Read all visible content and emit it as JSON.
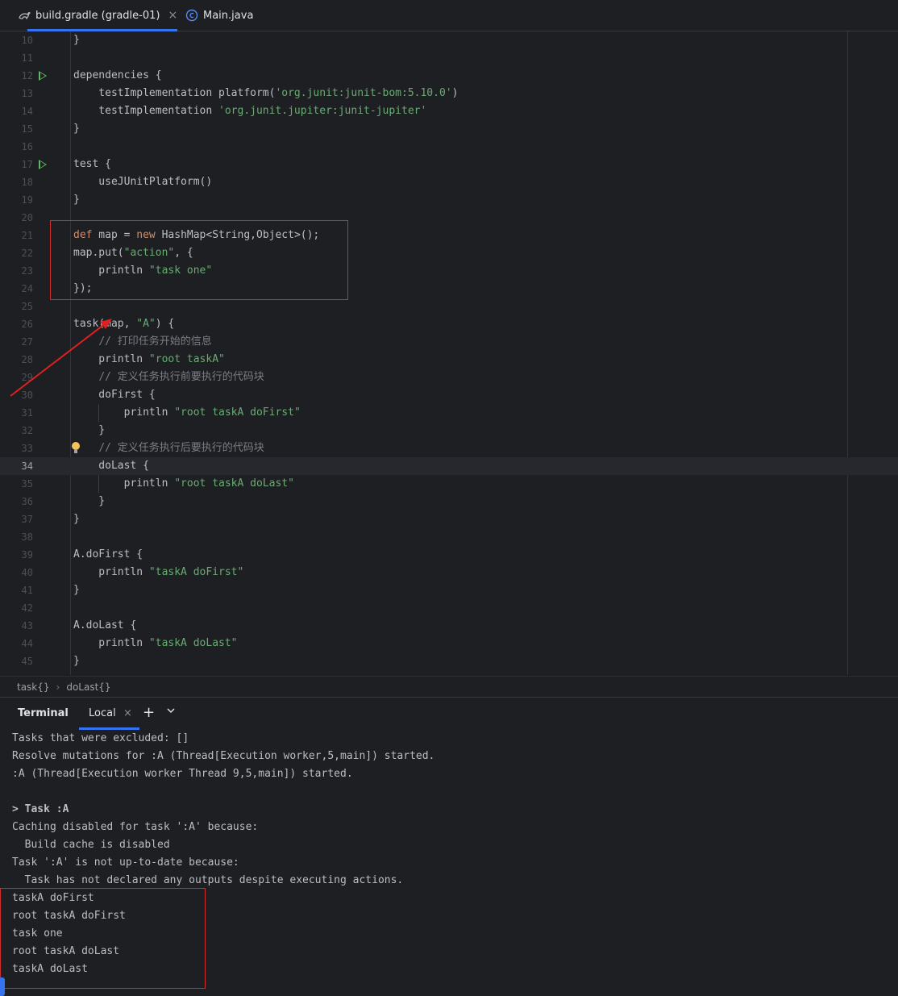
{
  "tabs": [
    {
      "label": "build.gradle (gradle-01)",
      "icon": "gradle-icon",
      "active": true
    },
    {
      "label": "Main.java",
      "icon": "java-class-icon",
      "active": false
    }
  ],
  "editor": {
    "lines": [
      {
        "n": "10",
        "text": "}"
      },
      {
        "n": "11",
        "text": ""
      },
      {
        "n": "12",
        "text": "dependencies {",
        "run": true
      },
      {
        "n": "13",
        "text": "    testImplementation platform('org.junit:junit-bom:5.10.0')"
      },
      {
        "n": "14",
        "text": "    testImplementation 'org.junit.jupiter:junit-jupiter'"
      },
      {
        "n": "15",
        "text": "}"
      },
      {
        "n": "16",
        "text": ""
      },
      {
        "n": "17",
        "text": "test {",
        "run": true
      },
      {
        "n": "18",
        "text": "    useJUnitPlatform()"
      },
      {
        "n": "19",
        "text": "}"
      },
      {
        "n": "20",
        "text": ""
      },
      {
        "n": "21",
        "text": "def map = new HashMap<String,Object>();"
      },
      {
        "n": "22",
        "text": "map.put(\"action\", {"
      },
      {
        "n": "23",
        "text": "    println \"task one\""
      },
      {
        "n": "24",
        "text": "});"
      },
      {
        "n": "25",
        "text": ""
      },
      {
        "n": "26",
        "text": "task(map, \"A\") {"
      },
      {
        "n": "27",
        "text": "    // 打印任务开始的信息"
      },
      {
        "n": "28",
        "text": "    println \"root taskA\""
      },
      {
        "n": "29",
        "text": "    // 定义任务执行前要执行的代码块"
      },
      {
        "n": "30",
        "text": "    doFirst {"
      },
      {
        "n": "31",
        "text": "        println \"root taskA doFirst\""
      },
      {
        "n": "32",
        "text": "    }"
      },
      {
        "n": "33",
        "text": "    // 定义任务执行后要执行的代码块",
        "bulb": true
      },
      {
        "n": "34",
        "text": "    doLast {",
        "current": true
      },
      {
        "n": "35",
        "text": "        println \"root taskA doLast\""
      },
      {
        "n": "36",
        "text": "    }"
      },
      {
        "n": "37",
        "text": "}"
      },
      {
        "n": "38",
        "text": ""
      },
      {
        "n": "39",
        "text": "A.doFirst {"
      },
      {
        "n": "40",
        "text": "    println \"taskA doFirst\""
      },
      {
        "n": "41",
        "text": "}"
      },
      {
        "n": "42",
        "text": ""
      },
      {
        "n": "43",
        "text": "A.doLast {"
      },
      {
        "n": "44",
        "text": "    println \"taskA doLast\""
      },
      {
        "n": "45",
        "text": "}"
      }
    ]
  },
  "breadcrumb": [
    "task{}",
    "doLast{}"
  ],
  "terminal": {
    "title": "Terminal",
    "tab_label": "Local",
    "tab_close": "×",
    "add_icon": "+",
    "more_icon": "⌄",
    "lines": [
      "Tasks that were excluded: []",
      "Resolve mutations for :A (Thread[Execution worker,5,main]) started.",
      ":A (Thread[Execution worker Thread 9,5,main]) started.",
      "",
      "> Task :A",
      "Caching disabled for task ':A' because:",
      "  Build cache is disabled",
      "Task ':A' is not up-to-date because:",
      "  Task has not declared any outputs despite executing actions.",
      "taskA doFirst",
      "root taskA doFirst",
      "task one",
      "root taskA doLast",
      "taskA doLast"
    ]
  },
  "colors": {
    "background": "#1e1f22",
    "keyword": "#cf8e6d",
    "string": "#6aab73",
    "comment": "#7a7e85",
    "annotation": "#d12b2b",
    "accent": "#3574f0"
  }
}
